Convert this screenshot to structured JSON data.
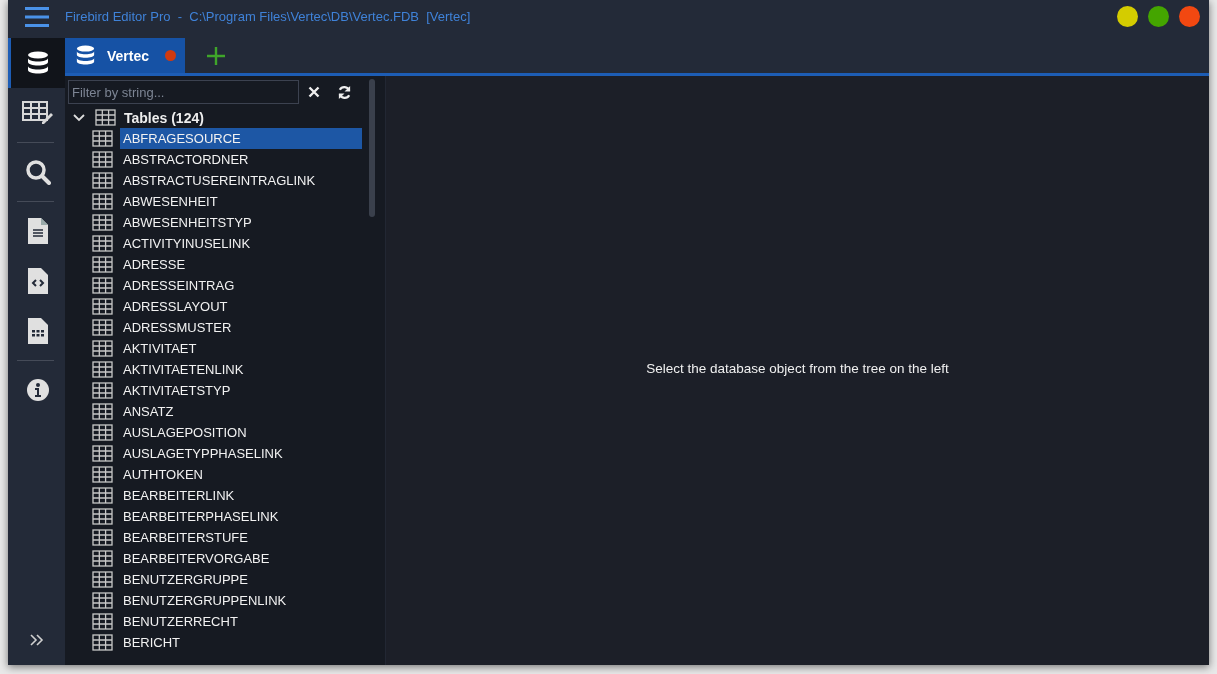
{
  "window": {
    "title": "Firebird Editor Pro  -  C:\\Program Files\\Vertec\\DB\\Vertec.FDB  [Vertec]",
    "controls": [
      {
        "color": "#d4cc00"
      },
      {
        "color": "#44a500"
      },
      {
        "color": "#f24811"
      }
    ]
  },
  "rail": {
    "groups": [
      [
        {
          "kind": "database",
          "selected": true
        },
        {
          "kind": "table-edit",
          "selected": false
        }
      ],
      [
        {
          "kind": "search",
          "selected": false
        }
      ],
      [
        {
          "kind": "document",
          "selected": false
        },
        {
          "kind": "code-file",
          "selected": false
        },
        {
          "kind": "sheet-file",
          "selected": false
        }
      ],
      [
        {
          "kind": "info",
          "selected": false
        }
      ]
    ]
  },
  "tabs": [
    {
      "label": "Vertec",
      "selected": true,
      "modified": true
    }
  ],
  "filter": {
    "placeholder": "Filter by string..."
  },
  "tree": [
    {
      "label": "Tables (124)",
      "expanded": true,
      "children": [
        {
          "label": "ABFRAGESOURCE",
          "selected": true
        },
        {
          "label": "ABSTRACTORDNER",
          "selected": false
        },
        {
          "label": "ABSTRACTUSEREINTRAGLINK",
          "selected": false
        },
        {
          "label": "ABWESENHEIT",
          "selected": false
        },
        {
          "label": "ABWESENHEITSTYP",
          "selected": false
        },
        {
          "label": "ACTIVITYINUSELINK",
          "selected": false
        },
        {
          "label": "ADRESSE",
          "selected": false
        },
        {
          "label": "ADRESSEINTRAG",
          "selected": false
        },
        {
          "label": "ADRESSLAYOUT",
          "selected": false
        },
        {
          "label": "ADRESSMUSTER",
          "selected": false
        },
        {
          "label": "AKTIVITAET",
          "selected": false
        },
        {
          "label": "AKTIVITAETENLINK",
          "selected": false
        },
        {
          "label": "AKTIVITAETSTYP",
          "selected": false
        },
        {
          "label": "ANSATZ",
          "selected": false
        },
        {
          "label": "AUSLAGEPOSITION",
          "selected": false
        },
        {
          "label": "AUSLAGETYPPHASELINK",
          "selected": false
        },
        {
          "label": "AUTHTOKEN",
          "selected": false
        },
        {
          "label": "BEARBEITERLINK",
          "selected": false
        },
        {
          "label": "BEARBEITERPHASELINK",
          "selected": false
        },
        {
          "label": "BEARBEITERSTUFE",
          "selected": false
        },
        {
          "label": "BEARBEITERVORGABE",
          "selected": false
        },
        {
          "label": "BENUTZERGRUPPE",
          "selected": false
        },
        {
          "label": "BENUTZERGRUPPENLINK",
          "selected": false
        },
        {
          "label": "BENUTZERRECHT",
          "selected": false
        },
        {
          "label": "BERICHT",
          "selected": false
        }
      ]
    }
  ],
  "content": {
    "message": "Select the database object from the tree on the left"
  }
}
